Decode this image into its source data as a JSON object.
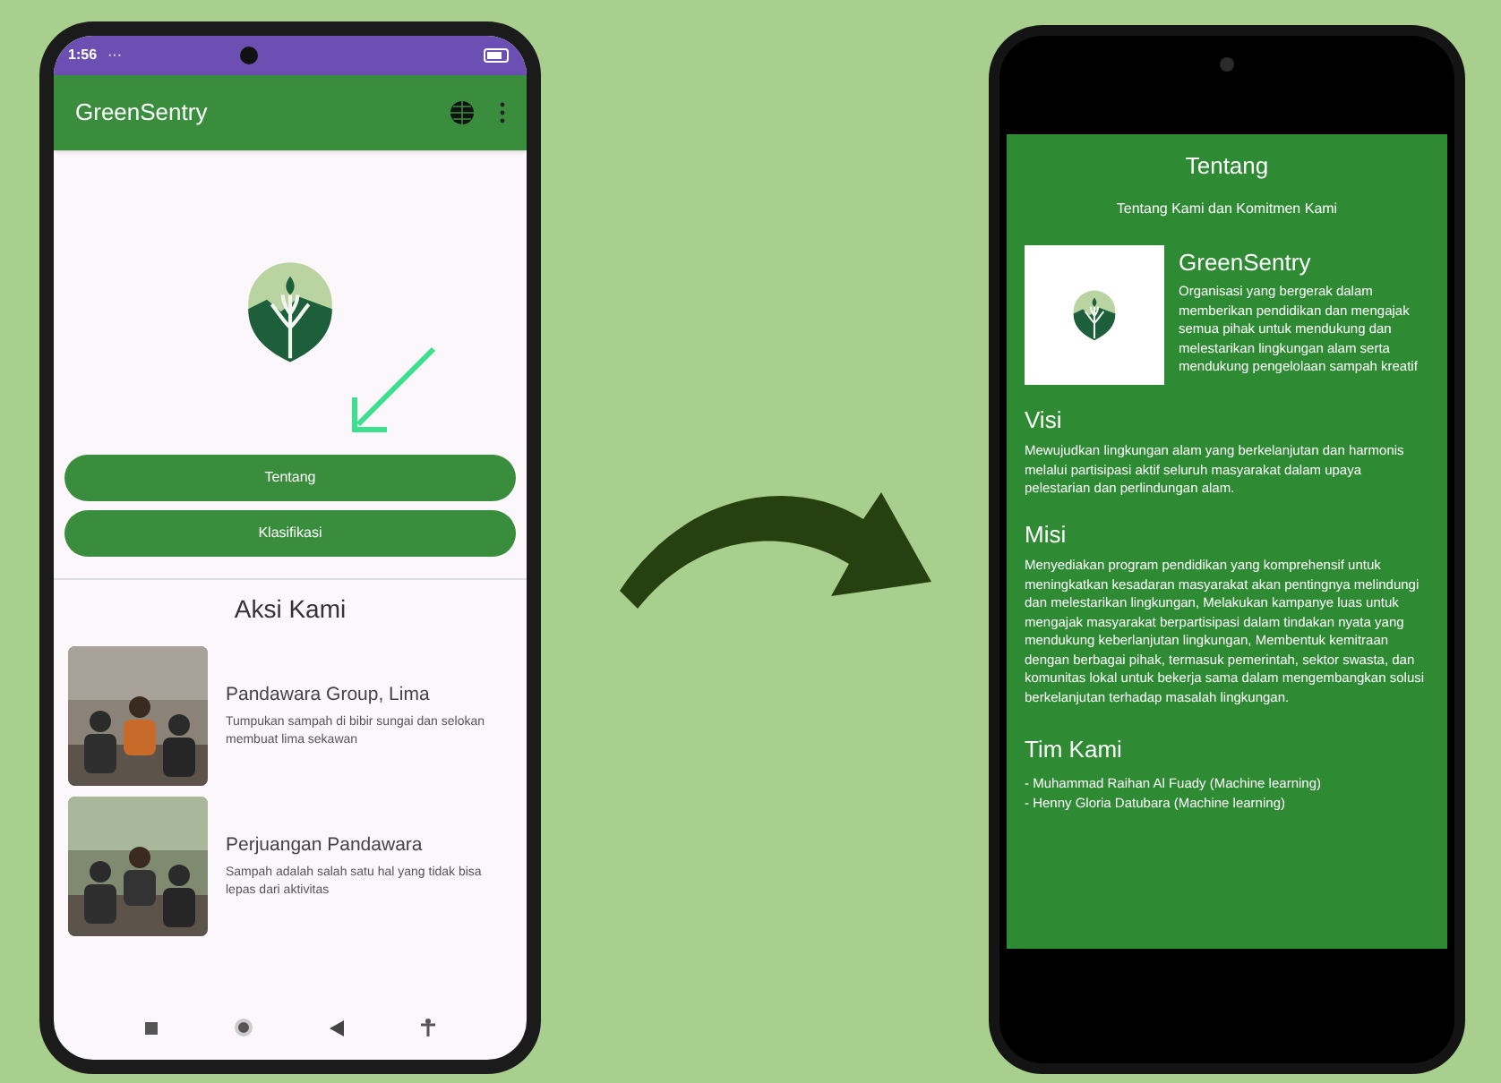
{
  "left_phone": {
    "status_bar": {
      "time": "1:56",
      "more": "···"
    },
    "app_bar": {
      "title": "GreenSentry"
    },
    "buttons": [
      "Tentang",
      "Klasifikasi"
    ],
    "section_title": "Aksi Kami",
    "cards": [
      {
        "kind": "picture",
        "title": "Pandawara Group, Lima",
        "description": "Tumpukan sampah di bibir sungai dan selokan membuat lima sekawan"
      },
      {
        "kind": "picture",
        "title": "Perjuangan Pandawara",
        "description": "Sampah adalah salah satu hal yang tidak bisa lepas dari aktivitas"
      }
    ]
  },
  "right_phone": {
    "title": "Tentang",
    "subtitle": "Tentang Kami dan Komitmen Kami",
    "org": {
      "name": "GreenSentry",
      "description": "Organisasi yang bergerak dalam memberikan pendidikan dan mengajak semua pihak untuk mendukung dan melestarikan lingkungan alam serta mendukung pengelolaan sampah kreatif"
    },
    "sections": [
      {
        "heading": "Visi",
        "body": "Mewujudkan lingkungan alam yang berkelanjutan dan harmonis melalui partisipasi aktif seluruh masyarakat dalam upaya pelestarian dan perlindungan alam."
      },
      {
        "heading": "Misi",
        "body": "Menyediakan program pendidikan yang komprehensif untuk meningkatkan kesadaran masyarakat akan pentingnya melindungi dan melestarikan lingkungan, Melakukan kampanye luas untuk mengajak masyarakat berpartisipasi dalam tindakan nyata yang mendukung keberlanjutan lingkungan, Membentuk kemitraan dengan berbagai pihak, termasuk pemerintah, sektor swasta, dan komunitas lokal untuk bekerja sama dalam mengembangkan solusi berkelanjutan terhadap masalah lingkungan."
      }
    ],
    "team": {
      "heading": "Tim Kami",
      "members": [
        "- Muhammad Raihan Al Fuady (Machine learning)",
        "- Henny Gloria Datubara (Machine learning)"
      ]
    }
  }
}
